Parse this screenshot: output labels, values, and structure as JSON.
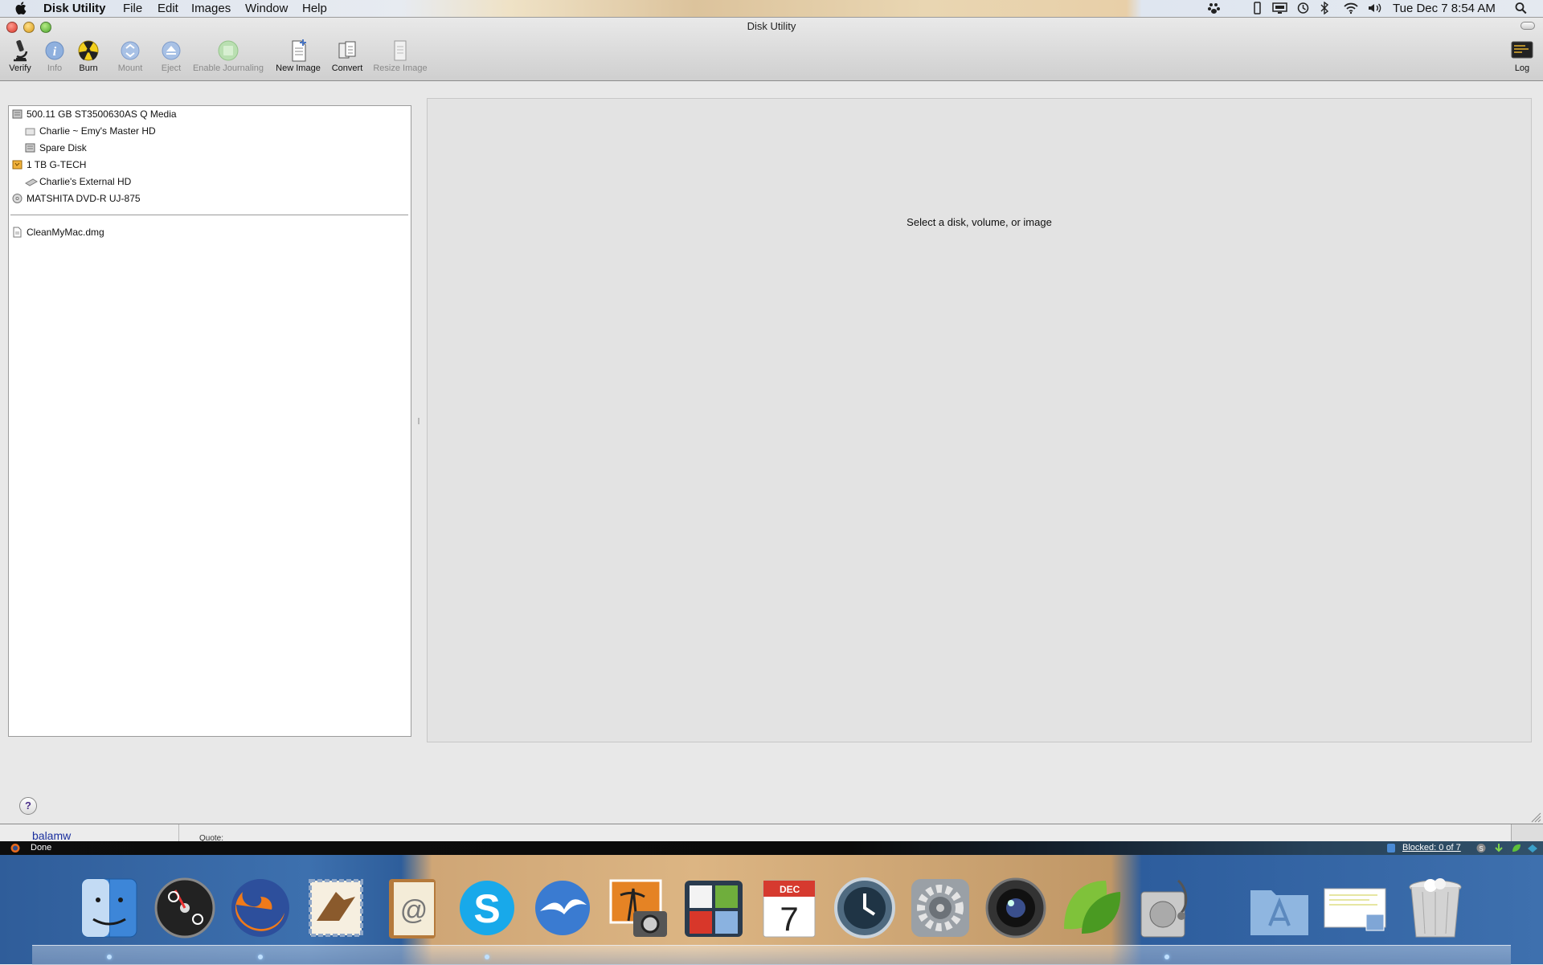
{
  "menubar": {
    "app_name": "Disk Utility",
    "menus": [
      "File",
      "Edit",
      "Images",
      "Window",
      "Help"
    ],
    "clock": "Tue Dec 7  8:54 AM"
  },
  "window": {
    "title": "Disk Utility"
  },
  "toolbar": {
    "verify": "Verify",
    "info": "Info",
    "burn": "Burn",
    "mount": "Mount",
    "eject": "Eject",
    "enable_journaling": "Enable Journaling",
    "new_image": "New Image",
    "convert": "Convert",
    "resize_image": "Resize Image",
    "log": "Log"
  },
  "sidebar": {
    "disks": [
      {
        "label": "500.11 GB ST3500630AS Q Media"
      },
      {
        "label": "Charlie ~ Emy's Master HD"
      },
      {
        "label": "Spare Disk"
      },
      {
        "label": "1 TB G-TECH"
      },
      {
        "label": "Charlie's External HD"
      },
      {
        "label": "MATSHITA DVD-R UJ-875"
      }
    ],
    "images": [
      {
        "label": "CleanMyMac.dmg"
      }
    ]
  },
  "detail": {
    "message": "Select a disk, volume, or image"
  },
  "help_label": "?",
  "background_window": {
    "user": "balamw",
    "quote": "Quote:"
  },
  "firefox_status": {
    "state": "Done",
    "blocked": "Blocked: 0 of 7"
  },
  "dock": {
    "apps": [
      "finder",
      "dashboard",
      "firefox",
      "mail",
      "address-book",
      "skype",
      "openoffice",
      "iphoto",
      "spaces",
      "ical",
      "time-machine",
      "system-preferences",
      "aperture",
      "coda",
      "disk-utility",
      "applications-folder",
      "documents-stack",
      "trash"
    ],
    "ical_month": "DEC",
    "ical_day": "7"
  },
  "colors": {
    "menubar": "#e4e9f0",
    "window_bg": "#e8e8e8",
    "detail_bg": "#e3e3e3",
    "dock_blue": "#3d70ae"
  }
}
